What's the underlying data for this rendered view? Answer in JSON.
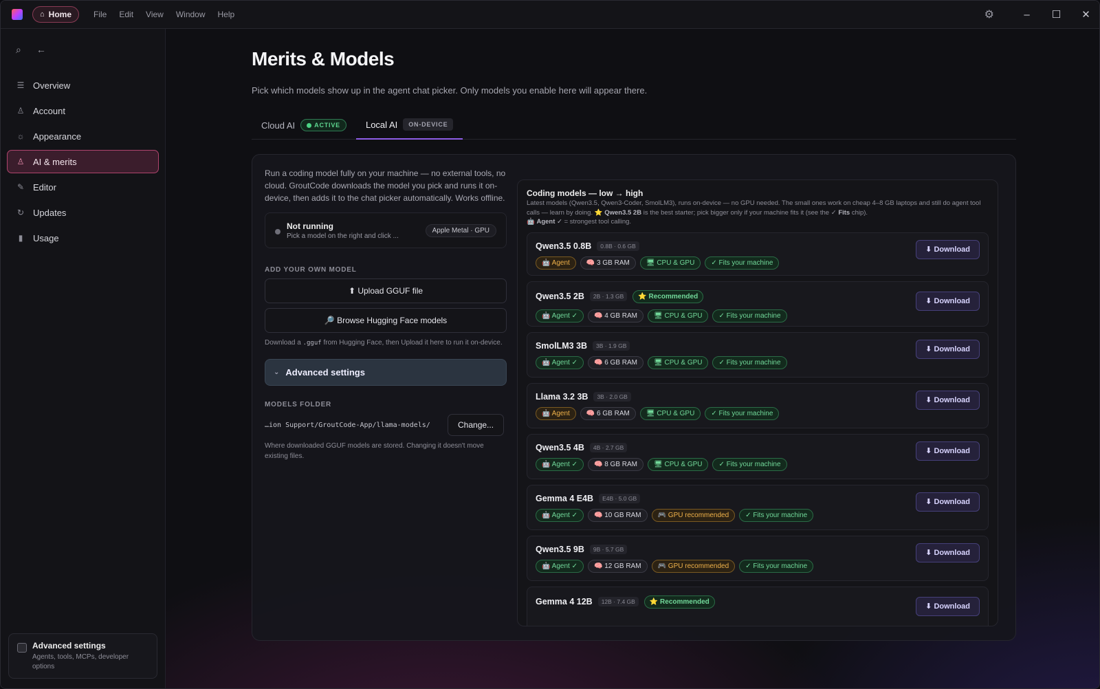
{
  "titlebar": {
    "home_label": "Home",
    "menu": [
      "File",
      "Edit",
      "View",
      "Window",
      "Help"
    ]
  },
  "sidebar": {
    "items": [
      {
        "label": "Overview",
        "icon": "sliders-icon"
      },
      {
        "label": "Account",
        "icon": "user-icon"
      },
      {
        "label": "Appearance",
        "icon": "sun-icon"
      },
      {
        "label": "AI & merits",
        "icon": "person-icon",
        "active": true
      },
      {
        "label": "Editor",
        "icon": "pencil-icon"
      },
      {
        "label": "Updates",
        "icon": "refresh-icon"
      },
      {
        "label": "Usage",
        "icon": "bar-chart-icon"
      }
    ],
    "advanced": {
      "title": "Advanced settings",
      "subtitle": "Agents, tools, MCPs, developer options"
    }
  },
  "main": {
    "title": "Merits & Models",
    "subtitle": "Pick which models show up in the agent chat picker. Only models you enable here will appear there.",
    "tabs": [
      {
        "label": "Cloud AI",
        "badge": "ACTIVE"
      },
      {
        "label": "Local AI",
        "badge": "ON-DEVICE"
      }
    ]
  },
  "local": {
    "intro": "Run a coding model fully on your machine — no external tools, no cloud. GroutCode downloads the model you pick and runs it on-device, then adds it to the chat picker automatically. Works offline.",
    "status": {
      "title": "Not running",
      "subtitle": "Pick a model on the right and click ...",
      "chip": "Apple Metal · GPU"
    },
    "add_label": "ADD YOUR OWN MODEL",
    "upload_label": "⬆ Upload GGUF file",
    "browse_label": "🔎 Browse Hugging Face models",
    "hint_pre": "Download a ",
    "hint_code": ".gguf",
    "hint_post": " from Hugging Face, then Upload it here to run it on-device.",
    "advanced_label": "Advanced settings",
    "folder_label": "MODELS FOLDER",
    "folder_path": "…ion Support/GroutCode-App/llama-models/",
    "change_label": "Change...",
    "folder_hint": "Where downloaded GGUF models are stored. Changing it doesn't move existing files."
  },
  "coding": {
    "title": "Coding models — low → high",
    "desc_1": "Latest models (Qwen3.5, Qwen3-Coder, SmolLM3), runs on-device — no GPU needed. The small ones work on cheap 4–8 GB laptops and still do agent tool calls — learn by doing. ⭐ ",
    "desc_bold": "Qwen3.5 2B",
    "desc_2": " is the best starter; pick bigger only if your machine fits it (see the ✓ ",
    "desc_bold2": "Fits",
    "desc_3": " chip).",
    "desc_line2_a": "🤖 ",
    "desc_line2_bold": "Agent ✓",
    "desc_line2_b": " = strongest tool calling.",
    "download_label": "⬇ Download",
    "models": [
      {
        "name": "Qwen3.5 0.8B",
        "size": "0.8B · 0.6 GB",
        "rec": "",
        "agent": "🤖 Agent",
        "agent_style": "o",
        "ram": "🧠 3 GB RAM",
        "compute": "🖥 CPU & GPU",
        "compute_style": "cpu",
        "fit": "✓ Fits your machine"
      },
      {
        "name": "Qwen3.5 2B",
        "size": "2B · 1.3 GB",
        "rec": "⭐ Recommended",
        "agent": "🤖 Agent ✓",
        "agent_style": "g",
        "ram": "🧠 4 GB RAM",
        "compute": "🖥 CPU & GPU",
        "compute_style": "cpu",
        "fit": "✓ Fits your machine"
      },
      {
        "name": "SmolLM3 3B",
        "size": "3B · 1.9 GB",
        "rec": "",
        "agent": "🤖 Agent ✓",
        "agent_style": "g",
        "ram": "🧠 6 GB RAM",
        "compute": "🖥 CPU & GPU",
        "compute_style": "cpu",
        "fit": "✓ Fits your machine"
      },
      {
        "name": "Llama 3.2 3B",
        "size": "3B · 2.0 GB",
        "rec": "",
        "agent": "🤖 Agent",
        "agent_style": "o",
        "ram": "🧠 6 GB RAM",
        "compute": "🖥 CPU & GPU",
        "compute_style": "cpu",
        "fit": "✓ Fits your machine"
      },
      {
        "name": "Qwen3.5 4B",
        "size": "4B · 2.7 GB",
        "rec": "",
        "agent": "🤖 Agent ✓",
        "agent_style": "g",
        "ram": "🧠 8 GB RAM",
        "compute": "🖥 CPU & GPU",
        "compute_style": "cpu",
        "fit": "✓ Fits your machine"
      },
      {
        "name": "Gemma 4 E4B",
        "size": "E4B · 5.0 GB",
        "rec": "",
        "agent": "🤖 Agent ✓",
        "agent_style": "g",
        "ram": "🧠 10 GB RAM",
        "compute": "🎮 GPU recommended",
        "compute_style": "gpu",
        "fit": "✓ Fits your machine"
      },
      {
        "name": "Qwen3.5 9B",
        "size": "9B · 5.7 GB",
        "rec": "",
        "agent": "🤖 Agent ✓",
        "agent_style": "g",
        "ram": "🧠 12 GB RAM",
        "compute": "🎮 GPU recommended",
        "compute_style": "gpu",
        "fit": "✓ Fits your machine"
      },
      {
        "name": "Gemma 4 12B",
        "size": "12B · 7.4 GB",
        "rec": "⭐ Recommended",
        "agent": "",
        "agent_style": "g",
        "ram": "",
        "compute": "",
        "compute_style": "cpu",
        "fit": ""
      }
    ]
  }
}
